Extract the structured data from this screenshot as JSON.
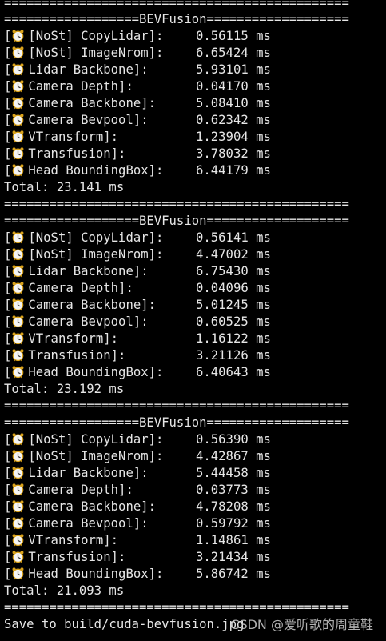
{
  "separator": "==============================================",
  "blocks": [
    {
      "header": "==================BEVFusion===================",
      "rows": [
        {
          "label": "[NoSt] CopyLidar]:",
          "value": "0.56115 ms"
        },
        {
          "label": "[NoSt] ImageNrom]:",
          "value": "6.65424 ms"
        },
        {
          "label": "Lidar Backbone]:",
          "value": "5.93101 ms"
        },
        {
          "label": "Camera Depth]:",
          "value": "0.04170 ms"
        },
        {
          "label": "Camera Backbone]:",
          "value": "5.08410 ms"
        },
        {
          "label": "Camera Bevpool]:",
          "value": "0.62342 ms"
        },
        {
          "label": "VTransform]:",
          "value": "1.23904 ms"
        },
        {
          "label": "Transfusion]:",
          "value": "3.78032 ms"
        },
        {
          "label": "Head BoundingBox]:",
          "value": "6.44179 ms"
        }
      ],
      "total": "Total: 23.141 ms"
    },
    {
      "header": "==================BEVFusion===================",
      "rows": [
        {
          "label": "[NoSt] CopyLidar]:",
          "value": "0.56141 ms"
        },
        {
          "label": "[NoSt] ImageNrom]:",
          "value": "4.47002 ms"
        },
        {
          "label": "Lidar Backbone]:",
          "value": "6.75430 ms"
        },
        {
          "label": "Camera Depth]:",
          "value": "0.04096 ms"
        },
        {
          "label": "Camera Backbone]:",
          "value": "5.01245 ms"
        },
        {
          "label": "Camera Bevpool]:",
          "value": "0.60525 ms"
        },
        {
          "label": "VTransform]:",
          "value": "1.16122 ms"
        },
        {
          "label": "Transfusion]:",
          "value": "3.21126 ms"
        },
        {
          "label": "Head BoundingBox]:",
          "value": "6.40643 ms"
        }
      ],
      "total": "Total: 23.192 ms"
    },
    {
      "header": "==================BEVFusion===================",
      "rows": [
        {
          "label": "[NoSt] CopyLidar]:",
          "value": "0.56390 ms"
        },
        {
          "label": "[NoSt] ImageNrom]:",
          "value": "4.42867 ms"
        },
        {
          "label": "Lidar Backbone]:",
          "value": "5.44458 ms"
        },
        {
          "label": "Camera Depth]:",
          "value": "0.03773 ms"
        },
        {
          "label": "Camera Backbone]:",
          "value": "4.78208 ms"
        },
        {
          "label": "Camera Bevpool]:",
          "value": "0.59792 ms"
        },
        {
          "label": "VTransform]:",
          "value": "1.14861 ms"
        },
        {
          "label": "Transfusion]:",
          "value": "3.21434 ms"
        },
        {
          "label": "Head BoundingBox]:",
          "value": "5.86742 ms"
        }
      ],
      "total": "Total: 21.093 ms"
    }
  ],
  "row_icon": "alarm-clock-icon",
  "footer": "Save to build/cuda-bevfusion.jpg",
  "watermark": "CSDN @爱听歌的周童鞋"
}
